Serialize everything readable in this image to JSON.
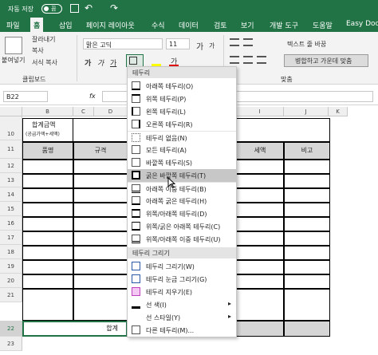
{
  "titlebar": {
    "autosave": "자동 저장",
    "autosave_state": "끔"
  },
  "tabs": [
    "파일",
    "홈",
    "삽입",
    "페이지 레이아웃",
    "수식",
    "데이터",
    "검토",
    "보기",
    "개발 도구",
    "도움말",
    "Easy Doc"
  ],
  "ribbon": {
    "paste": "붙여넣기",
    "cut": "잘라내기",
    "copy": "복사",
    "format_painter": "서식 복사",
    "clipboard": "클립보드",
    "font_name": "맑은 고딕",
    "font_size": "11",
    "font_grow": "가",
    "font_shrink": "가",
    "bold": "가",
    "italic": "가",
    "underline": "가",
    "font_color_glyph": "가",
    "wrap_text": "텍스트 줄 바꿈",
    "merge_center": "병합하고 가운데 맞춤",
    "alignment": "맞춤"
  },
  "formula_bar": {
    "name_box": "B22",
    "fx": "fx"
  },
  "columns": [
    "A",
    "B",
    "C",
    "D",
    "E",
    "F",
    "G",
    "H",
    "I",
    "J",
    "K"
  ],
  "rows": [
    "10",
    "11",
    "12",
    "13",
    "14",
    "15",
    "16",
    "17",
    "18",
    "19",
    "20",
    "21",
    "22",
    "23"
  ],
  "sheet": {
    "title_label": "합계금액",
    "title_sub": "(공급가액+세액)",
    "hdr_item": "품명",
    "hdr_spec": "규격",
    "hdr_tax": "세액",
    "hdr_note": "비고",
    "total_label": "합계"
  },
  "menu": {
    "section_borders": "테두리",
    "items": [
      {
        "label": "아래쪽 테두리(O)",
        "icon": "border-bottom-icon"
      },
      {
        "label": "위쪽 테두리(P)",
        "icon": "border-top-icon"
      },
      {
        "label": "왼쪽 테두리(L)",
        "icon": "border-left-icon"
      },
      {
        "label": "오른쪽 테두리(R)",
        "icon": "border-right-icon"
      },
      {
        "label": "테두리 없음(N)",
        "icon": "border-none-icon"
      },
      {
        "label": "모든 테두리(A)",
        "icon": "border-all-icon"
      },
      {
        "label": "바깥쪽 테두리(S)",
        "icon": "border-outside-icon"
      },
      {
        "label": "굵은 바깥쪽 테두리(T)",
        "icon": "border-thick-outside-icon"
      },
      {
        "label": "아래쪽 이중 테두리(B)",
        "icon": "border-double-bottom-icon"
      },
      {
        "label": "아래쪽 굵은 테두리(H)",
        "icon": "border-thick-bottom-icon"
      },
      {
        "label": "위쪽/아래쪽 테두리(D)",
        "icon": "border-top-bottom-icon"
      },
      {
        "label": "위쪽/굵은 아래쪽 테두리(C)",
        "icon": "border-top-thick-bottom-icon"
      },
      {
        "label": "위쪽/아래쪽 이중 테두리(U)",
        "icon": "border-top-double-bottom-icon"
      }
    ],
    "section_draw": "테두리 그리기",
    "draw_items": [
      {
        "label": "테두리 그리기(W)",
        "icon": "pencil-border-icon"
      },
      {
        "label": "테두리 눈금 그리기(G)",
        "icon": "pencil-grid-icon"
      },
      {
        "label": "테두리 지우기(E)",
        "icon": "eraser-icon"
      },
      {
        "label": "선 색(I)",
        "icon": "line-color-icon"
      },
      {
        "label": "선 스타일(Y)",
        "icon": "line-style-icon"
      },
      {
        "label": "다른 테두리(M)...",
        "icon": "more-borders-icon"
      }
    ],
    "highlighted_index": 7,
    "submenu_arrow": "▸"
  }
}
